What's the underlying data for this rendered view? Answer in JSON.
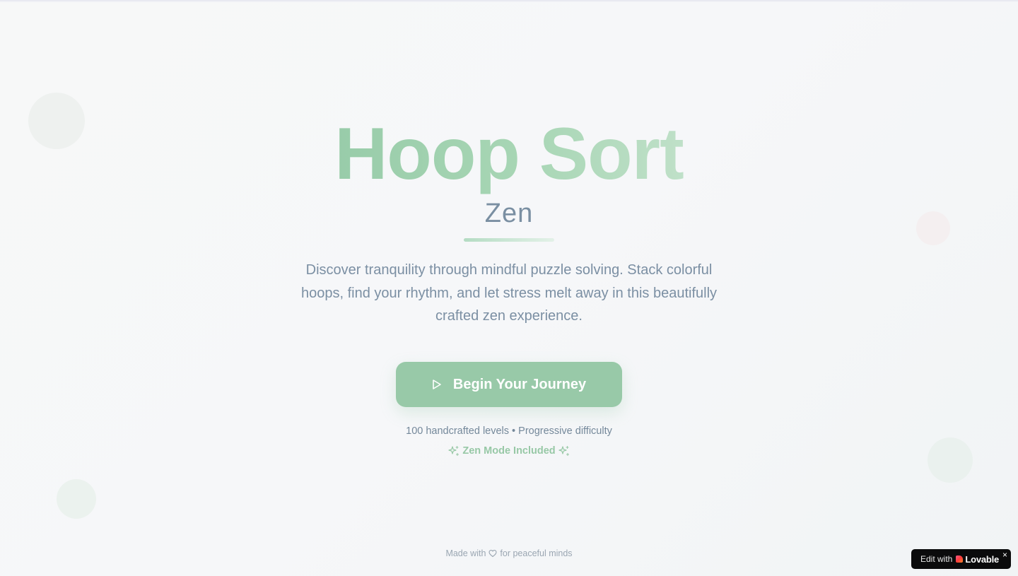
{
  "hero": {
    "title": "Hoop Sort",
    "subtitle": "Zen",
    "description": "Discover tranquility through mindful puzzle solving. Stack colorful hoops, find your rhythm, and let stress melt away in this beautifully crafted zen experience.",
    "cta_label": "Begin Your Journey",
    "levels_text": "100 handcrafted levels • Progressive difficulty",
    "zen_mode_text": "Zen Mode Included"
  },
  "footer": {
    "made_with": "Made with",
    "for_text": "for peaceful minds"
  },
  "badge": {
    "edit_with": "Edit with",
    "brand": "Lovable",
    "close": "×"
  },
  "icons": {
    "cta": "play-icon",
    "zen_left": "sparkles-icon",
    "zen_right": "sparkles-icon",
    "footer": "heart-icon",
    "badge": "lovable-logo-icon"
  },
  "colors": {
    "title_gradient_start": "#98cca9",
    "title_gradient_end": "#bfe0c8",
    "cta_background": "#98c9a8",
    "accent_text": "#97c8a6",
    "body_text": "#7b8fa3",
    "badge_background": "#0b0b0c"
  }
}
